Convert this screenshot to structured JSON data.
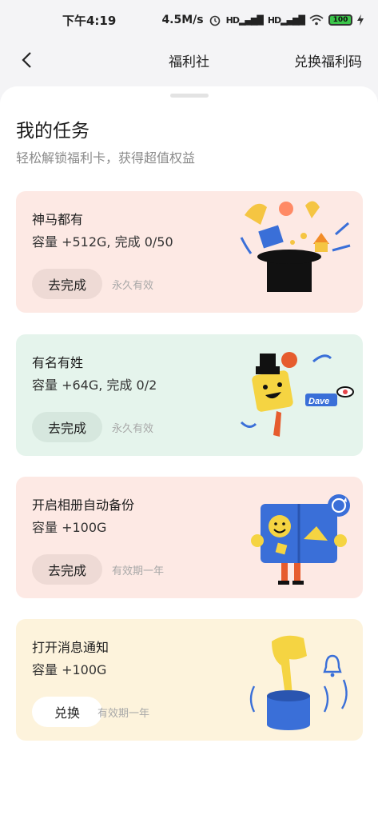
{
  "status_bar": {
    "time": "下午4:19",
    "net_speed": "4.5M/s",
    "signal1": "HD",
    "signal2": "HD",
    "battery": "100"
  },
  "nav": {
    "title": "福利社",
    "action": "兑换福利码"
  },
  "section": {
    "title": "我的任务",
    "subtitle": "轻松解锁福利卡，获得超值权益"
  },
  "tasks": [
    {
      "title": "神马都有",
      "desc": "容量 +512G, 完成 0/50",
      "button": "去完成",
      "validity": "永久有效",
      "bg": "#fde9e4"
    },
    {
      "title": "有名有姓",
      "desc": "容量 +64G, 完成 0/2",
      "button": "去完成",
      "validity": "永久有效",
      "bg": "#e5f4ec"
    },
    {
      "title": "开启相册自动备份",
      "desc": "容量 +100G",
      "button": "去完成",
      "validity": "有效期一年",
      "bg": "#fde9e4"
    },
    {
      "title": "打开消息通知",
      "desc": "容量 +100G",
      "button": "兑换",
      "validity": "有效期一年",
      "bg": "#fdf3dc"
    }
  ],
  "illustrations": {
    "card2_tag": "Dave"
  }
}
